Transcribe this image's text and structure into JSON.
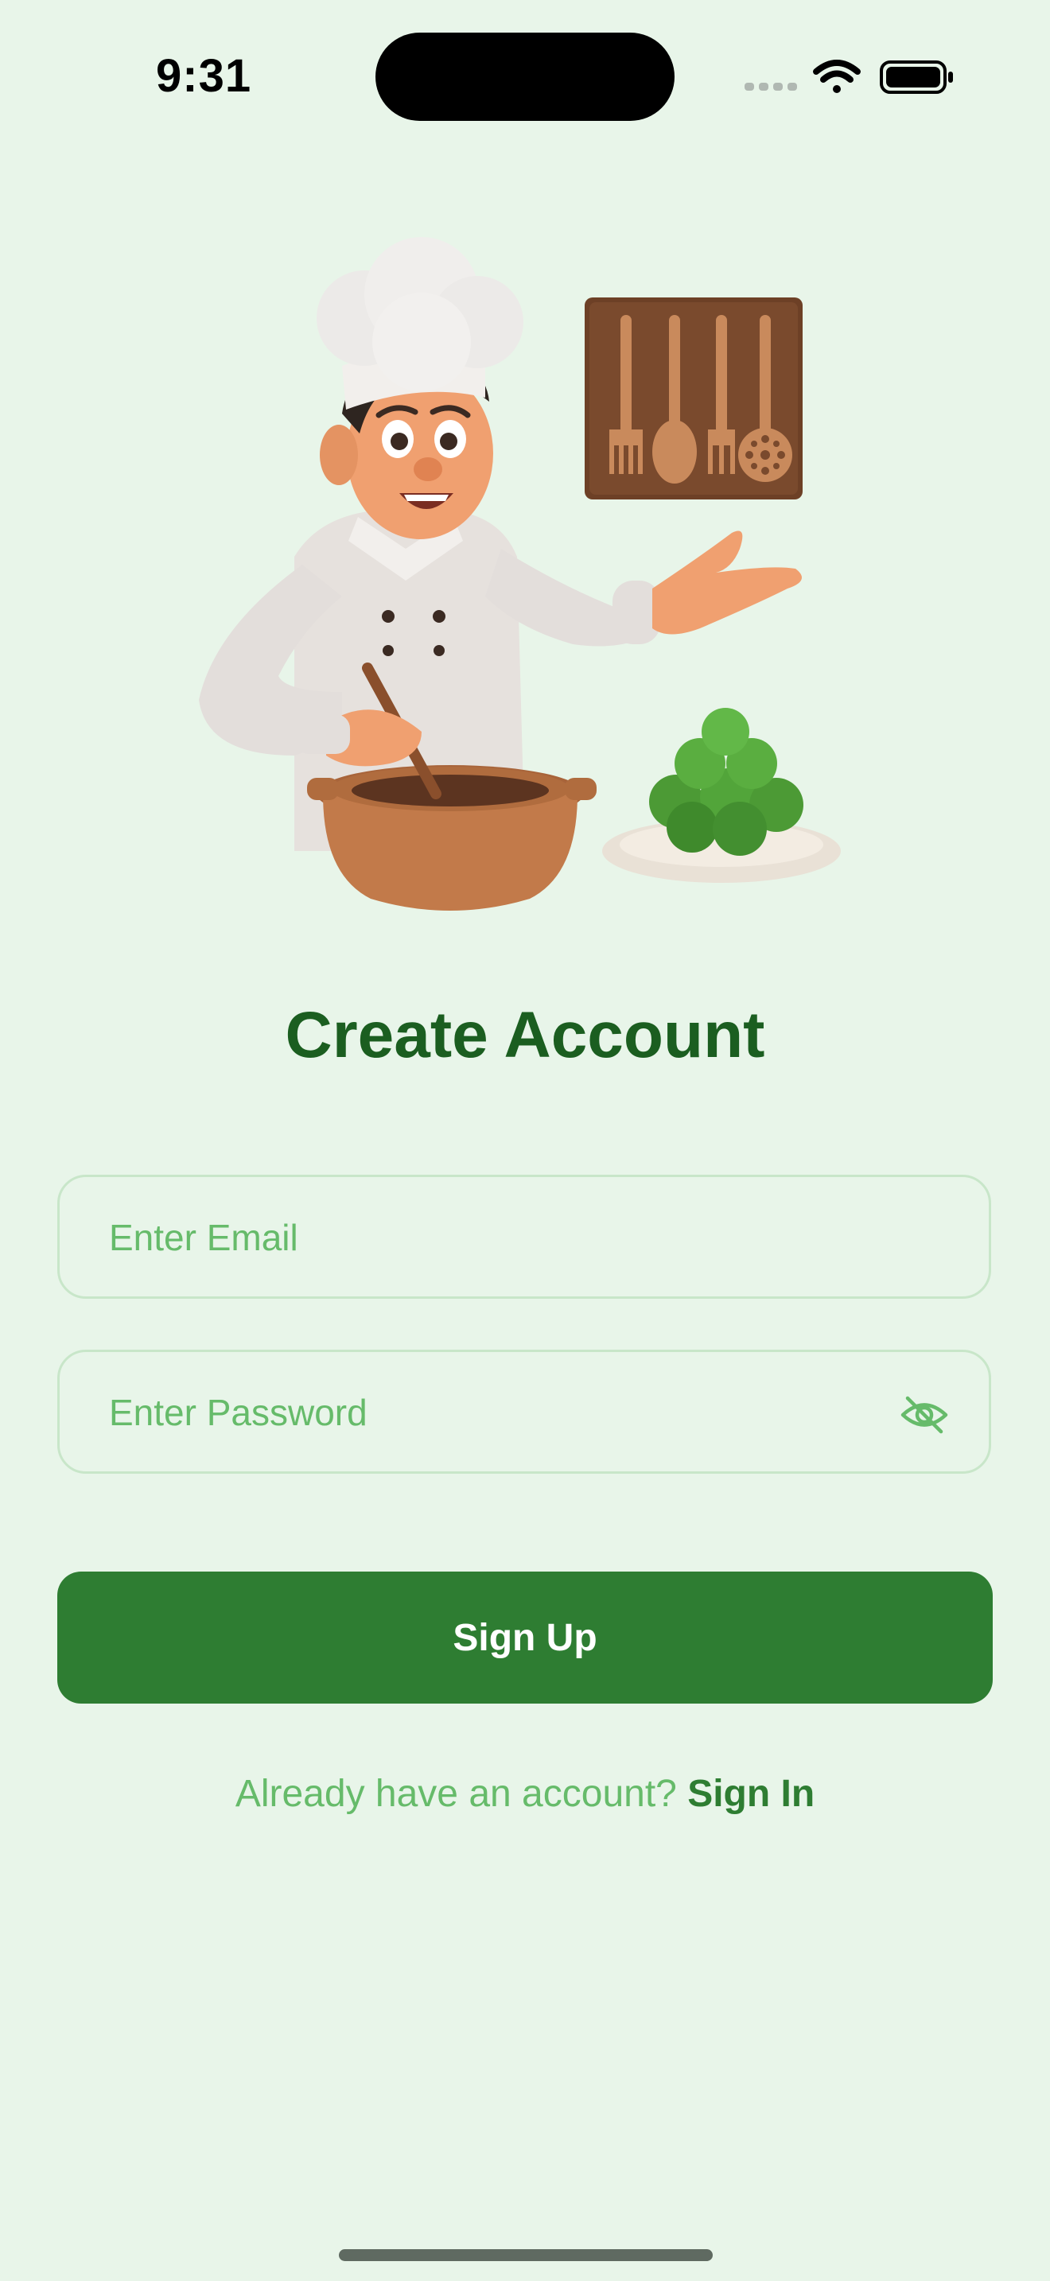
{
  "status_bar": {
    "time": "9:31",
    "icons": [
      "signal-dots-icon",
      "wifi-icon",
      "battery-icon"
    ]
  },
  "hero": {
    "icons": [
      "chef-illustration",
      "utensil-board-icon",
      "cooking-pot-icon",
      "green-balls-plate-icon"
    ]
  },
  "header": {
    "title": "Create Account"
  },
  "form": {
    "email_placeholder": "Enter Email",
    "email_value": "",
    "password_placeholder": "Enter Password",
    "password_value": "",
    "password_toggle_icon": "eye-off-icon"
  },
  "actions": {
    "signup_label": "Sign Up"
  },
  "footer": {
    "prompt": "Already have an account?",
    "signin_label": "Sign In"
  },
  "colors": {
    "background": "#e8f5e9",
    "primary": "#2e7d32",
    "title": "#1b5e20",
    "placeholder": "#66bb6a",
    "field_border": "#c8e6c9"
  }
}
